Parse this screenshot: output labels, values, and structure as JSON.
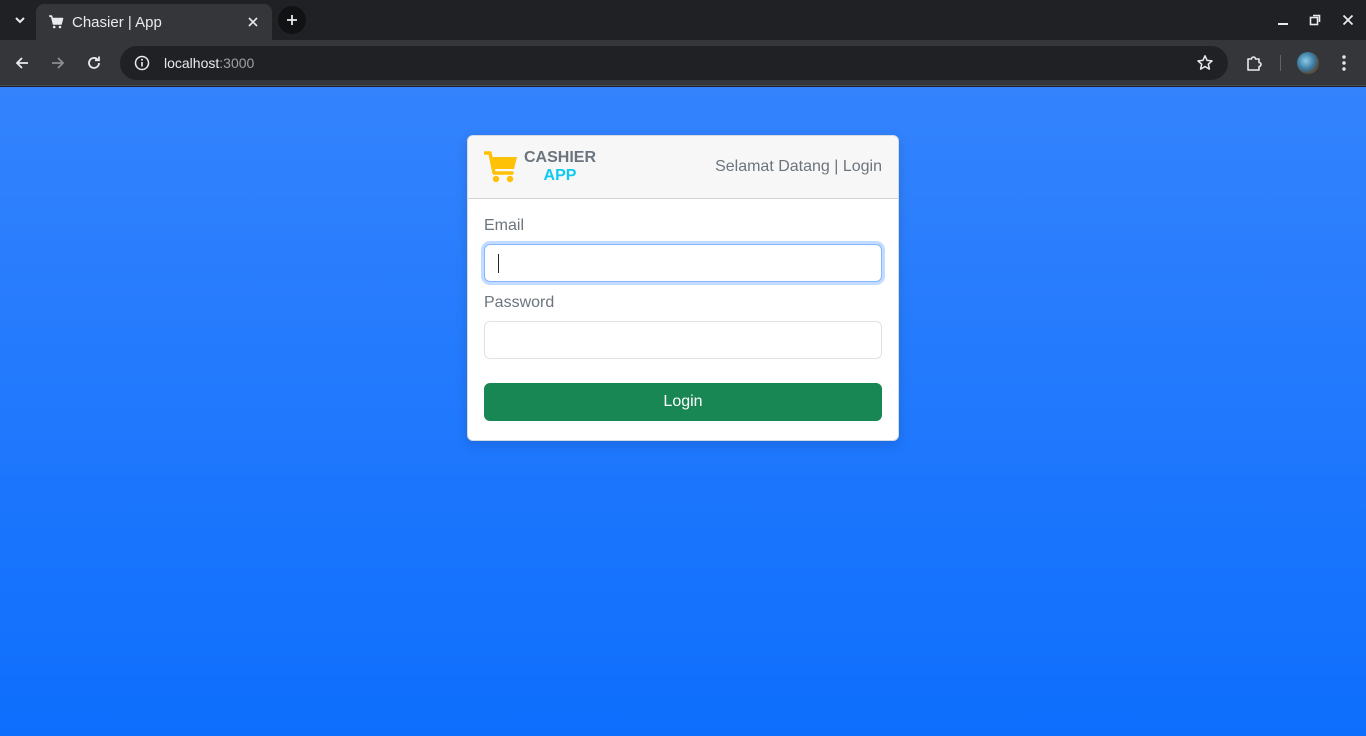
{
  "browser": {
    "tab_title": "Chasier | App",
    "url_host": "localhost",
    "url_port": ":3000",
    "icons": [
      "tab-search-icon",
      "cart-favicon-icon",
      "close-icon",
      "plus-icon",
      "minimize-icon",
      "restore-icon",
      "close-window-icon",
      "back-icon",
      "forward-icon",
      "reload-icon",
      "site-info-icon",
      "star-icon",
      "extensions-icon",
      "profile-avatar",
      "more-menu-icon"
    ]
  },
  "login_card": {
    "brand_line1": "CASHIER",
    "brand_line2": "APP",
    "header_right": "Selamat Datang | Login",
    "email_label": "Email",
    "email_value": "",
    "password_label": "Password",
    "password_value": "",
    "submit_label": "Login"
  },
  "colors": {
    "background_top": "#3483fd",
    "background_bottom": "#0d6efd",
    "cart_icon": "#ffc107",
    "brand_accent": "#0dcaf0",
    "login_button": "#198754"
  }
}
